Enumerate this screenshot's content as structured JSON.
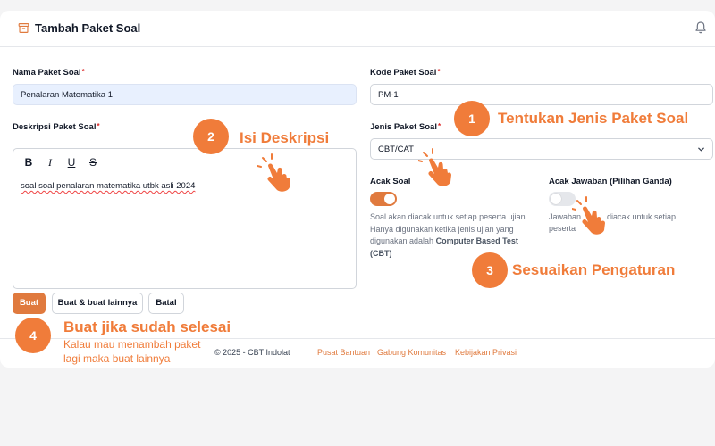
{
  "header": {
    "title": "Tambah Paket Soal",
    "icon": "archive-box-icon",
    "bell_icon": "bell-icon"
  },
  "form": {
    "nama": {
      "label": "Nama Paket Soal",
      "required_mark": "*",
      "value": "Penalaran Matematika 1"
    },
    "kode": {
      "label": "Kode Paket Soal",
      "required_mark": "*",
      "value": "PM-1"
    },
    "deskripsi": {
      "label": "Deskripsi Paket Soal",
      "required_mark": "*",
      "toolbar": {
        "bold": "B",
        "italic": "I",
        "underline": "U",
        "strike": "S"
      },
      "value": "soal soal penalaran matematika utbk asli 2024"
    },
    "jenis": {
      "label": "Jenis Paket Soal",
      "required_mark": "*",
      "selected": "CBT/CAT"
    },
    "acak_soal": {
      "label": "Acak Soal",
      "enabled": true,
      "hint_pre": "Soal akan diacak untuk setiap peserta ujian. Hanya digunakan ketika jenis ujian yang digunakan adalah ",
      "hint_bold": "Computer Based Test (CBT)"
    },
    "acak_jawaban": {
      "label": "Acak Jawaban (Pilihan Ganda)",
      "enabled": false,
      "hint_a": "Jawaban",
      "hint_b": "diacak untuk setiap",
      "hint_c": "peserta"
    }
  },
  "actions": {
    "create": "Buat",
    "create_more": "Buat & buat lainnya",
    "cancel": "Batal"
  },
  "footer": {
    "copyright": "© 2025 - CBT Indolat",
    "links": [
      "Pusat Bantuan",
      "Gabung Komunitas",
      "Kebijakan Privasi"
    ]
  },
  "annotations": {
    "step1": {
      "num": "1",
      "text": "Tentukan Jenis Paket Soal"
    },
    "step2": {
      "num": "2",
      "text": "Isi Deskripsi"
    },
    "step3": {
      "num": "3",
      "text": "Sesuaikan Pengaturan"
    },
    "step4": {
      "num": "4",
      "text": "Buat jika sudah selesai",
      "sub1": "Kalau mau menambah paket",
      "sub2": "lagi maka buat lainnya"
    }
  },
  "colors": {
    "accent": "#e07a3e",
    "annotation": "#f07c3a",
    "autofill": "#e8f0fe"
  }
}
